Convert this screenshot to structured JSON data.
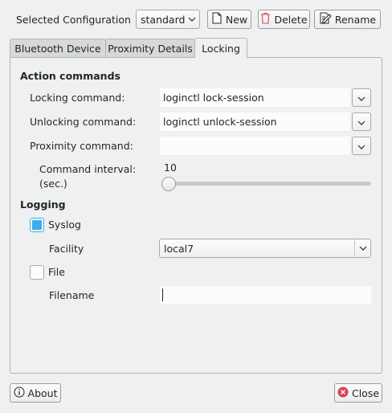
{
  "config": {
    "label": "Selected Configuration",
    "selected": "standard",
    "new_label": "New",
    "delete_label": "Delete",
    "rename_label": "Rename"
  },
  "tabs": [
    {
      "label": "Bluetooth Device",
      "active": false
    },
    {
      "label": "Proximity Details",
      "active": false
    },
    {
      "label": "Locking",
      "active": true
    }
  ],
  "action_commands": {
    "heading": "Action commands",
    "locking_label": "Locking command:",
    "locking_value": "loginctl lock-session",
    "unlocking_label": "Unlocking command:",
    "unlocking_value": "loginctl unlock-session",
    "proximity_label": "Proximity command:",
    "proximity_value": "",
    "interval_label_line1": "Command interval:",
    "interval_label_line2": "(sec.)",
    "interval_value": "10"
  },
  "logging": {
    "heading": "Logging",
    "syslog_label": "Syslog",
    "syslog_checked": true,
    "facility_label": "Facility",
    "facility_value": "local7",
    "file_label": "File",
    "file_checked": false,
    "filename_label": "Filename",
    "filename_value": ""
  },
  "footer": {
    "about_label": "About",
    "close_label": "Close"
  },
  "colors": {
    "accent": "#3daee9",
    "close_icon": "#da4453"
  }
}
